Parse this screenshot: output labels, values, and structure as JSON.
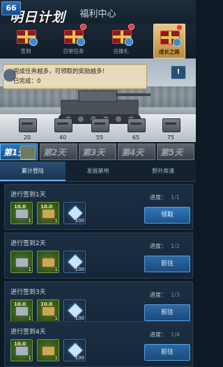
{
  "header": {
    "level": "66",
    "logo_text": "明日计划",
    "title": "福利中心"
  },
  "tabs": [
    {
      "label": "签到",
      "active": false,
      "dot": false
    },
    {
      "label": "日常任务",
      "active": false,
      "dot": true
    },
    {
      "label": "兑换礼",
      "active": false,
      "dot": true
    },
    {
      "label": "成长之路",
      "active": true,
      "dot": true
    }
  ],
  "banner": {
    "message": "完成任务越多，可领取的奖励越多！",
    "completed_label": "已完成：",
    "completed_value": "0",
    "info_icon": "exclamation-icon",
    "milestones": [
      "20",
      "40",
      "55",
      "65",
      "75"
    ]
  },
  "days": [
    "第1天",
    "第2天",
    "第3天",
    "第4天",
    "第5天"
  ],
  "subtabs": [
    "累计登陆",
    "发展基地",
    "野外席清"
  ],
  "tasks": [
    {
      "title": "进行签到1天",
      "progress_label": "进度：",
      "progress": "1/1",
      "button": "领取",
      "rewards": [
        {
          "type": "silver",
          "badge": "10.0",
          "count": "1"
        },
        {
          "type": "gold",
          "badge": "10.0",
          "count": "1"
        },
        {
          "type": "gem",
          "badge": "",
          "count": "100"
        }
      ]
    },
    {
      "title": "进行签到2天",
      "progress_label": "进度：",
      "progress": "1/2",
      "button": "前往",
      "rewards": [
        {
          "type": "silver",
          "badge": "",
          "count": "1"
        },
        {
          "type": "gold",
          "badge": "",
          "count": "1"
        },
        {
          "type": "gem",
          "badge": "",
          "count": "100"
        }
      ]
    },
    {
      "title": "进行签到3天",
      "progress_label": "进度：",
      "progress": "1/3",
      "button": "前往",
      "rewards": [
        {
          "type": "silver",
          "badge": "10.0",
          "count": "1"
        },
        {
          "type": "gold",
          "badge": "10.0",
          "count": "1"
        },
        {
          "type": "gem",
          "badge": "",
          "count": "100"
        }
      ]
    },
    {
      "title": "进行签到4天",
      "progress_label": "进度：",
      "progress": "1/4",
      "button": "前往",
      "rewards": [
        {
          "type": "silver",
          "badge": "10.0",
          "count": "1"
        },
        {
          "type": "gold",
          "badge": "",
          "count": "1"
        },
        {
          "type": "gem",
          "badge": "",
          "count": "100"
        }
      ]
    }
  ]
}
